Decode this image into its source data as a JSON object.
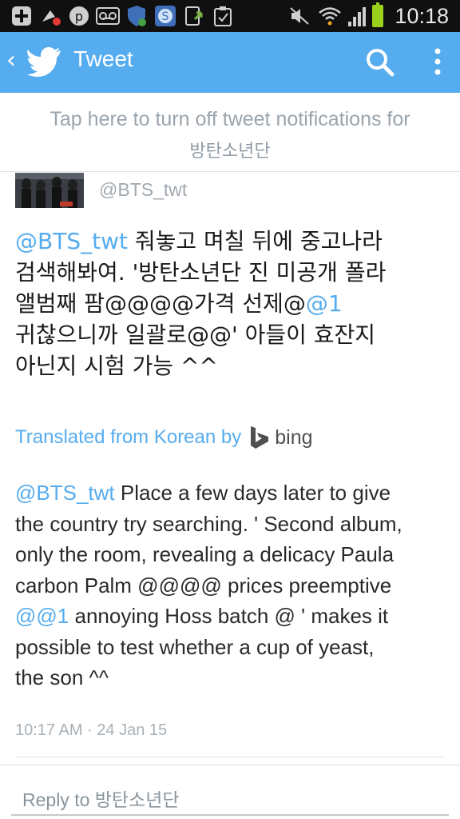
{
  "status_bar": {
    "time": "10:18",
    "icons": [
      "add-icon",
      "weather-icon",
      "pinterest-icon",
      "voicemail-icon",
      "shield-icon",
      "skype-icon",
      "upload-icon",
      "clipboard-icon",
      "mute-icon",
      "wifi-icon",
      "signal-icon",
      "battery-icon"
    ]
  },
  "action_bar": {
    "title": "Tweet",
    "accent_color": "#55acee"
  },
  "notification": {
    "line1": "Tap here to turn off tweet notifications for",
    "line2": "방탄소년단"
  },
  "tweet": {
    "handle": "@BTS_twt",
    "text_lines": [
      {
        "mention": "@BTS_twt",
        "rest": " 줘놓고 며칠 뒤에 중고나라"
      },
      {
        "rest": "검색해봐여. '방탄소년단 진 미공개 폴라"
      },
      {
        "pre": "앨범째 팜@@@@가격 선제@",
        "mention": "@1"
      },
      {
        "rest": "귀찮으니까 일괄로@@' 아들이 효잔지"
      },
      {
        "rest": "아닌지 시험 가능 ^^"
      }
    ],
    "translated_label": "Translated from Korean by",
    "translator": "bing",
    "translation_lines": [
      {
        "mention": "@BTS_twt",
        "rest": " Place a few days later to give"
      },
      {
        "rest": "the country try searching. ' Second album,"
      },
      {
        "rest": "only the room, revealing a delicacy Paula"
      },
      {
        "rest": "carbon Palm @@@@ prices preemptive"
      },
      {
        "pre": "@",
        "mention": "@1",
        "rest": " annoying Hoss batch @ ' makes it"
      },
      {
        "rest": "possible to test whether a cup of yeast,"
      },
      {
        "rest": "the son ^^"
      }
    ],
    "timestamp": "10:17 AM · 24 Jan 15"
  },
  "reply": {
    "placeholder": "Reply to 방탄소년단"
  }
}
